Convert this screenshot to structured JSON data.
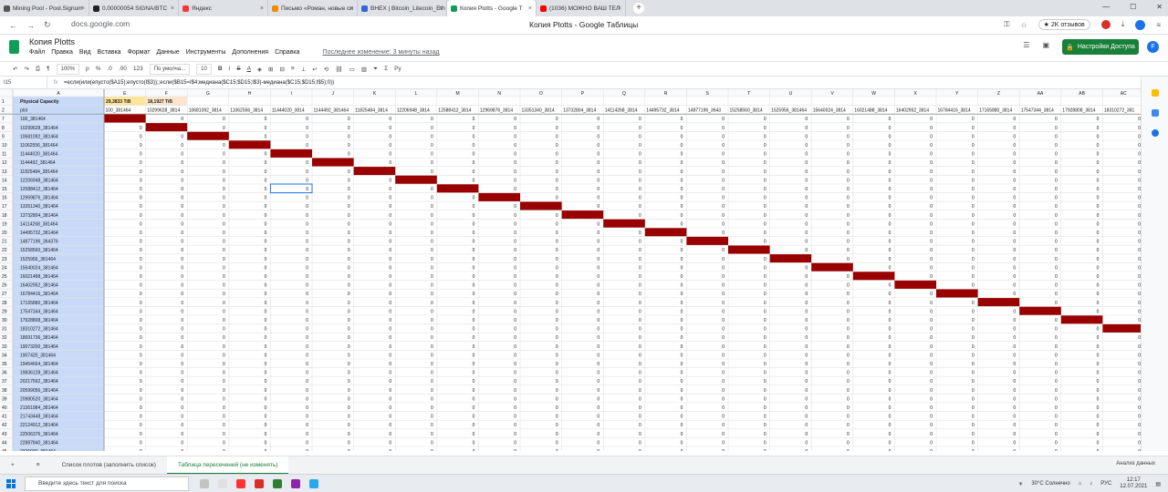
{
  "browser": {
    "tabs": [
      {
        "label": "Mining Pool - Pool.Signum",
        "color": "#555555"
      },
      {
        "label": "0,00000054 SIGNA/BTC",
        "color": "#222222"
      },
      {
        "label": "Яндекс",
        "color": "#ff3333"
      },
      {
        "label": "Письмо «Роман, новые си",
        "color": "#f28b00"
      },
      {
        "label": "BHEX | Bitcoin_Litecoin_Eth",
        "color": "#3367d6"
      },
      {
        "label": "Копия Plotts - Google Т",
        "color": "#0f9d58"
      },
      {
        "label": "(1036) МОЖНО ВАШ ТЕЛ",
        "color": "#ff0000"
      }
    ],
    "url": "docs.google.com",
    "page_title": "Копия Plotts - Google Таблицы",
    "reviews": "★ 2K отзывов",
    "avatar": "F"
  },
  "sheets": {
    "title": "Копия Plotts",
    "menu": [
      "Файл",
      "Правка",
      "Вид",
      "Вставка",
      "Формат",
      "Данные",
      "Инструменты",
      "Дополнения",
      "Справка"
    ],
    "last_edit": "Последнее изменение: 3 минуты назад",
    "share": "Настройки Доступа",
    "toolbar": {
      "zoom": "100%",
      "currency": "р",
      "percent": "%",
      "dec0": ".0",
      "dec00": ".00",
      "fmt": "123",
      "font": "По умолча...",
      "size": "10"
    },
    "formula": {
      "cell": "I15",
      "text": "=если(или(епусто($A15);епусто(I$3));;если($B15=I$4;медиана($C15;$D15;I$3)-медиана($C15;$D15;I$5);0))"
    },
    "col_letters": [
      "A",
      "E",
      "F",
      "G",
      "H",
      "I",
      "J",
      "K",
      "L",
      "M",
      "N",
      "O",
      "P",
      "Q",
      "R",
      "S",
      "T",
      "U",
      "V",
      "W",
      "X",
      "Y",
      "Z",
      "AA",
      "AB",
      "AC"
    ],
    "row_header_label": "Physical Capacity",
    "row_plot": "plot",
    "capacity": [
      "29,3833 TiB",
      "18,1927 TiB"
    ],
    "col_headers": [
      "100_381464",
      "10299628_3814",
      "10681092_3814",
      "11062556_3814",
      "11444020_3814",
      "1144492_381464",
      "11825484_3814",
      "12206948_3814",
      "12588412_3814",
      "12969876_3814",
      "13351340_3814",
      "13732804_3814",
      "14114268_3814",
      "14495732_3814",
      "14877196_3643",
      "15258560_3814",
      "1525956_381464",
      "15640024_3814",
      "16021488_3814",
      "16402952_3814",
      "16784416_3814",
      "17165880_3814",
      "17547344_3814",
      "17928808_3814",
      "18310272_381"
    ],
    "row_numbers": [
      "7",
      "8",
      "9",
      "10",
      "11",
      "12",
      "13",
      "14",
      "15",
      "16",
      "17",
      "18",
      "19",
      "20",
      "21",
      "22",
      "23",
      "24",
      "25",
      "26",
      "27",
      "28",
      "29",
      "30",
      "31",
      "32",
      "33",
      "34",
      "35",
      "36",
      "37",
      "38",
      "39",
      "40",
      "41",
      "42",
      "43",
      "44",
      "45"
    ],
    "row_labels": [
      "100_381464",
      "10299628_381464",
      "10681092_381464",
      "11062556_381464",
      "11444020_381464",
      "1144492_381464",
      "11825484_381464",
      "12206948_381464",
      "12588412_381464",
      "12969876_381464",
      "13351340_381464",
      "13732804_381464",
      "14114268_381464",
      "14495732_381464",
      "14877196_364376",
      "15258560_381464",
      "1525956_381464",
      "15640024_381464",
      "16021488_381464",
      "16402952_381464",
      "16784416_381464",
      "17165880_381464",
      "17547344_381464",
      "17928808_381464",
      "18310272_381464",
      "18691736_381464",
      "19073200_381464",
      "1907420_381464",
      "19454664_381464",
      "19836128_381464",
      "20217592_381464",
      "20599056_381464",
      "20980520_381464",
      "21361984_381464",
      "21743448_381464",
      "22124912_381464",
      "22506376_381464",
      "22887840_381464",
      "2326930_381464"
    ],
    "zero": "0",
    "accent_dark_red": "#990000",
    "sheet_tabs": [
      "Список плотов (заполнить список)",
      "Таблица пересечений (не изменять)"
    ],
    "explore": "Анализ данных"
  },
  "taskbar": {
    "search": "Введите здесь текст для поиска",
    "weather": "30°C Солнечно",
    "lang": "РУС",
    "time": "12:17",
    "date": "12.07.2021"
  }
}
